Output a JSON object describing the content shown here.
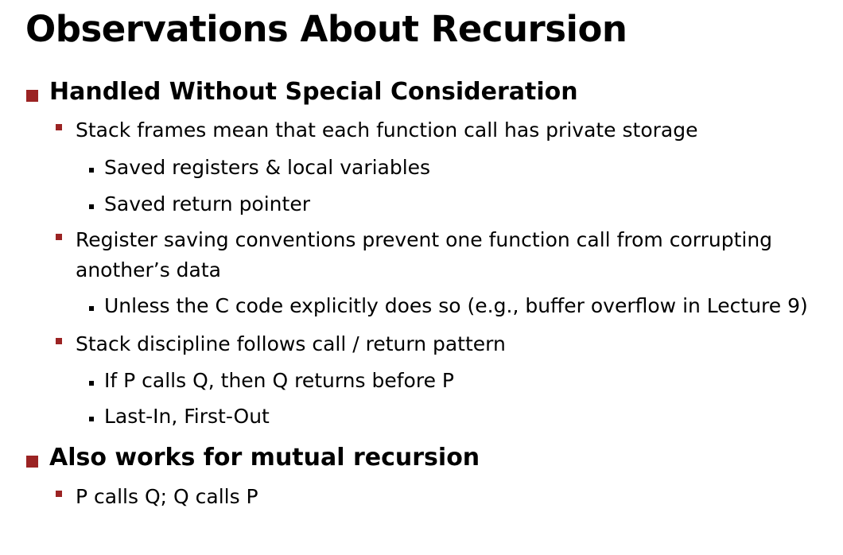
{
  "slide": {
    "title": "Observations About Recursion",
    "items": [
      {
        "text": "Handled Without Special Consideration",
        "children": [
          {
            "text": "Stack frames mean that each function call has private storage",
            "children": [
              {
                "text": "Saved registers & local variables"
              },
              {
                "text": "Saved return pointer"
              }
            ]
          },
          {
            "text_lines": [
              "Register saving conventions prevent one function call from corrupting",
              "another’s data"
            ],
            "children": [
              {
                "text": "Unless the C code explicitly does so (e.g., buffer overflow in Lecture 9)"
              }
            ]
          },
          {
            "text": "Stack discipline follows call / return pattern",
            "children": [
              {
                "text": "If P calls Q, then Q returns before P"
              },
              {
                "text": "Last-In, First-Out"
              }
            ]
          }
        ]
      },
      {
        "text": "Also works for mutual recursion",
        "children": [
          {
            "text": "P calls Q; Q calls P"
          }
        ]
      }
    ],
    "colors": {
      "bullet_accent": "#9b2323",
      "text": "#000000",
      "background": "#ffffff"
    }
  }
}
